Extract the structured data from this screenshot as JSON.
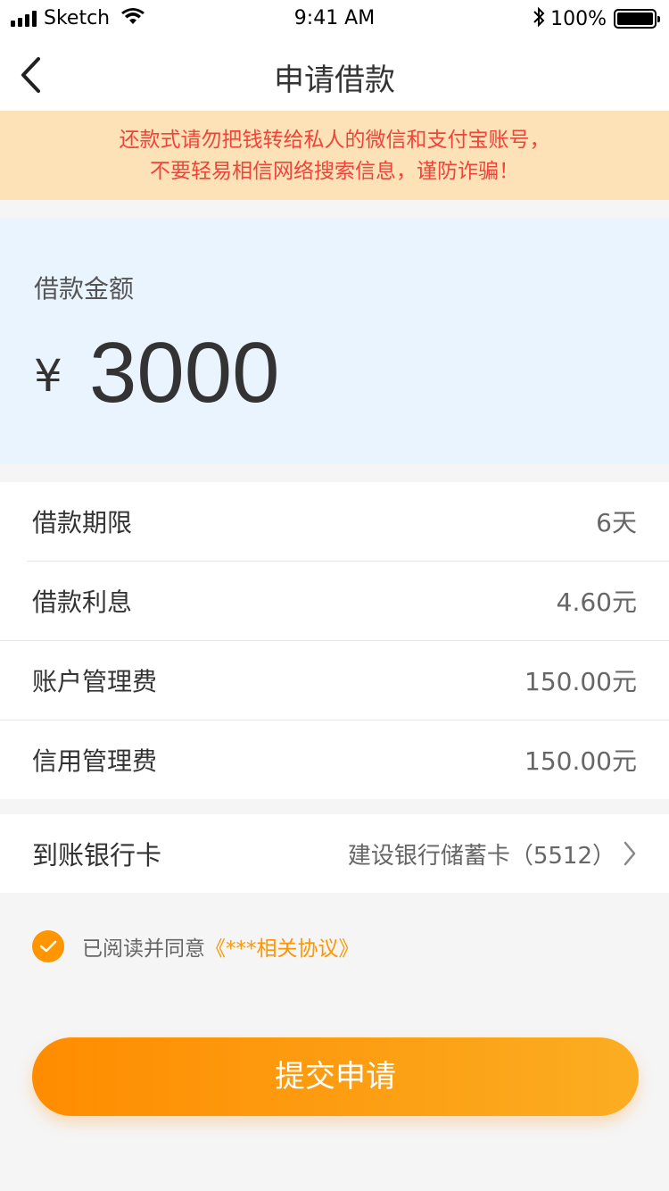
{
  "status_bar": {
    "carrier": "Sketch",
    "time": "9:41 AM",
    "battery": "100%"
  },
  "nav": {
    "title": "申请借款",
    "back_icon": "chevron-left-icon"
  },
  "warning": {
    "line1": "还款式请勿把钱转给私人的微信和支付宝账号，",
    "line2": "不要轻易相信网络搜索信息，谨防诈骗！"
  },
  "amount": {
    "label": "借款金额",
    "currency": "¥",
    "value": "3000"
  },
  "details": [
    {
      "label": "借款期限",
      "value": "6天"
    },
    {
      "label": "借款利息",
      "value": "4.60元"
    },
    {
      "label": "账户管理费",
      "value": "150.00元"
    },
    {
      "label": "信用管理费",
      "value": "150.00元"
    }
  ],
  "bank": {
    "label": "到账银行卡",
    "value": "建设银行储蓄卡（5512）"
  },
  "agreement": {
    "checked": true,
    "text": "已阅读并同意",
    "link": "《***相关协议》"
  },
  "submit_label": "提交申请",
  "colors": {
    "accent": "#ff9500",
    "warning_bg": "#fde2b8",
    "warning_text": "#f0443a",
    "amount_bg": "#eaf4ff"
  }
}
